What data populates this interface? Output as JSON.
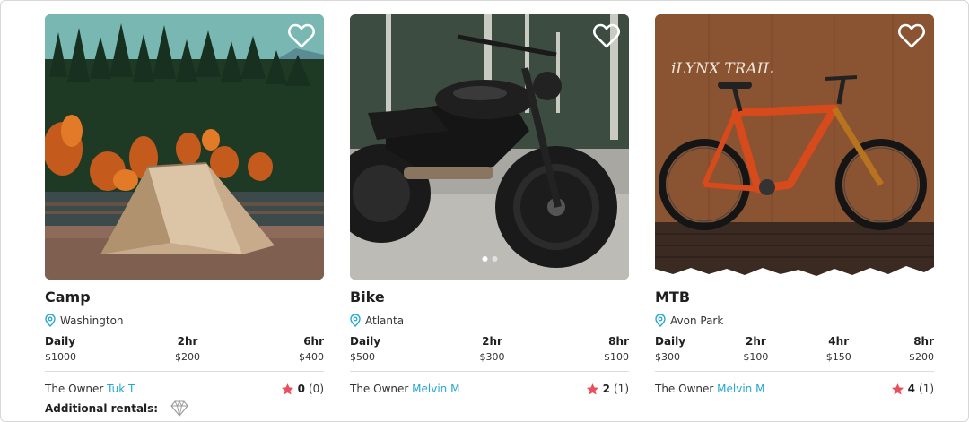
{
  "listings": [
    {
      "title": "Camp",
      "location": "Washington",
      "rates": [
        {
          "label": "Daily",
          "price": "$1000"
        },
        {
          "label": "2hr",
          "price": "$200"
        },
        {
          "label": "6hr",
          "price": "$400"
        }
      ],
      "owner_label": "The Owner",
      "owner_name": "Tuk T",
      "rating_score": "0",
      "rating_count": "(0)"
    },
    {
      "title": "Bike",
      "location": "Atlanta",
      "rates": [
        {
          "label": "Daily",
          "price": "$500"
        },
        {
          "label": "2hr",
          "price": "$300"
        },
        {
          "label": "8hr",
          "price": "$100"
        }
      ],
      "owner_label": "The Owner",
      "owner_name": "Melvin M",
      "rating_score": "2",
      "rating_count": "(1)"
    },
    {
      "title": "MTB",
      "location": "Avon Park",
      "rates": [
        {
          "label": "Daily",
          "price": "$300"
        },
        {
          "label": "2hr",
          "price": "$100"
        },
        {
          "label": "4hr",
          "price": "$150"
        },
        {
          "label": "8hr",
          "price": "$200"
        }
      ],
      "owner_label": "The Owner",
      "owner_name": "Melvin M",
      "rating_score": "4",
      "rating_count": "(1)",
      "photo_sign": "iLYNX TRAIL"
    }
  ],
  "additional_rentals_label": "Additional rentals:",
  "icons": {
    "favorite": "heart-outline-icon",
    "location": "map-pin-icon",
    "rating": "star-icon",
    "additional": "diamond-icon"
  },
  "colors": {
    "accent": "#25a7d6",
    "star": "#e8505b",
    "divider": "#dcdcdc"
  }
}
